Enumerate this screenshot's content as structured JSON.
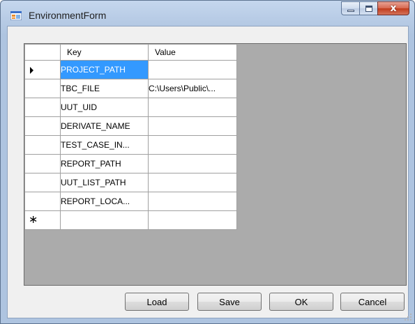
{
  "window": {
    "title": "EnvironmentForm",
    "caption_buttons": [
      "minimize-icon",
      "maximize-icon",
      "close-icon"
    ],
    "close_glyph": "x"
  },
  "grid": {
    "columns": [
      "Key",
      "Value"
    ],
    "rows": [
      {
        "key": "PROJECT_PATH",
        "value": "",
        "current": true,
        "selected_cell": "key"
      },
      {
        "key": "TBC_FILE",
        "value": "C:\\Users\\Public\\...",
        "current": false
      },
      {
        "key": "UUT_UID",
        "value": "",
        "current": false
      },
      {
        "key": "DERIVATE_NAME",
        "value": "",
        "current": false
      },
      {
        "key": "TEST_CASE_IN...",
        "value": "",
        "current": false
      },
      {
        "key": "REPORT_PATH",
        "value": "",
        "current": false
      },
      {
        "key": "UUT_LIST_PATH",
        "value": "",
        "current": false
      },
      {
        "key": "REPORT_LOCA...",
        "value": "",
        "current": false
      }
    ],
    "new_row_glyph": "∗",
    "current_row_icon": "row-pointer-icon"
  },
  "buttons": {
    "load": "Load",
    "save": "Save",
    "ok": "OK",
    "cancel": "Cancel"
  },
  "colors": {
    "selection": "#3399ff",
    "grid_background": "#ababab",
    "client_background": "#f0f0f0",
    "close_button": "#c13b1b"
  }
}
